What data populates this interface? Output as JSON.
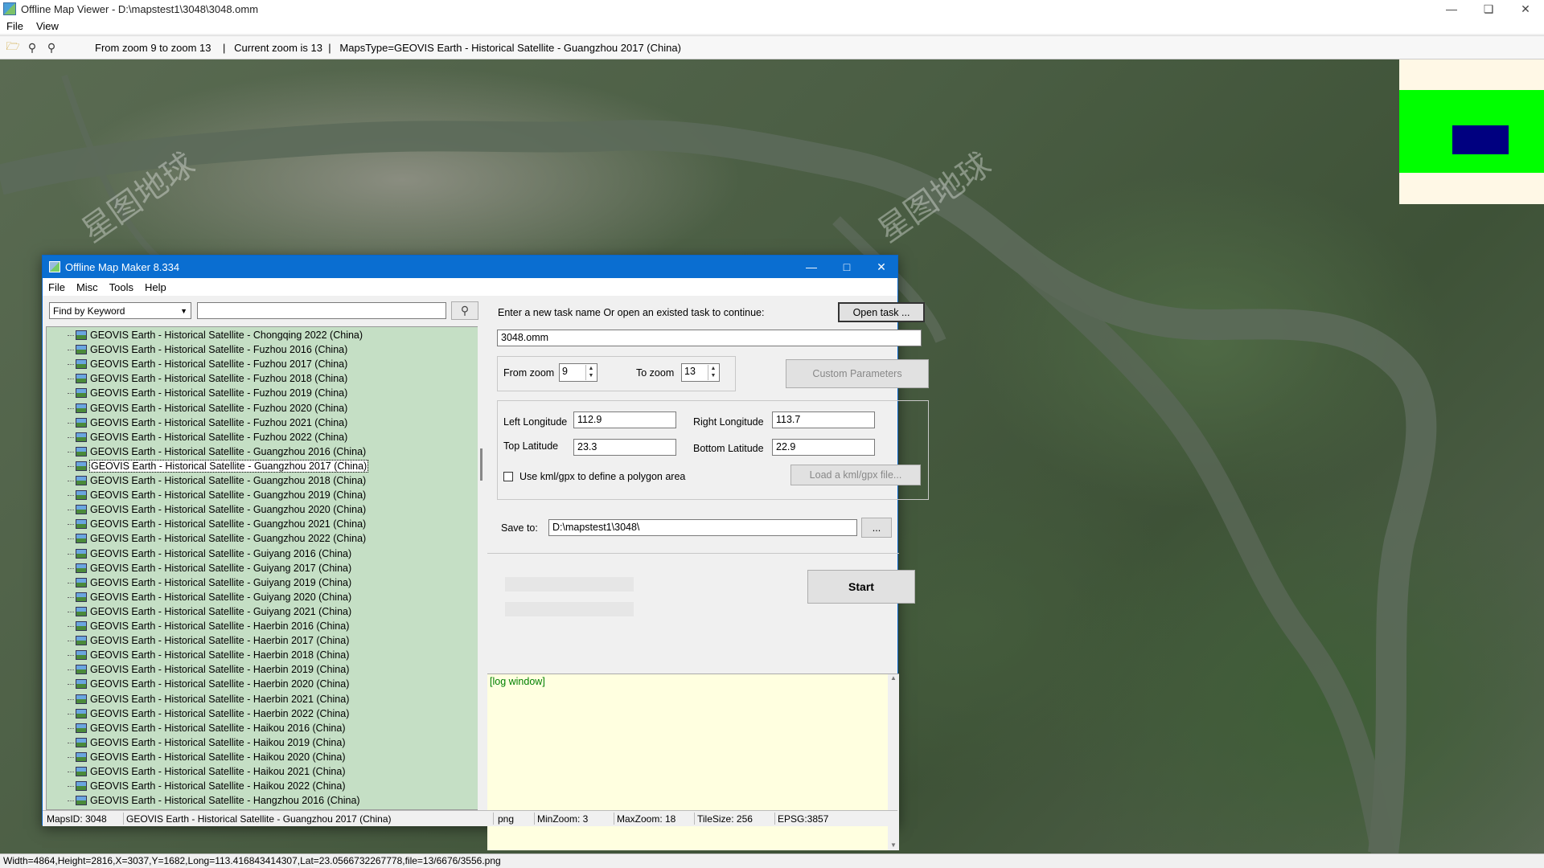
{
  "viewer": {
    "title": "Offline Map Viewer - D:\\mapstest1\\3048\\3048.omm",
    "menu": [
      "File",
      "View"
    ],
    "toolbar_info": "From zoom 9 to zoom 13    |   Current zoom is 13  |   MapsType=GEOVIS Earth - Historical Satellite - Guangzhou 2017 (China)",
    "icons": [
      "folder-open-icon",
      "zoom-out-icon",
      "zoom-in-icon"
    ],
    "status": "Width=4864,Height=2816,X=3037,Y=1682,Long=113.416843414307,Lat=23.0566732267778,file=13/6676/3556.png",
    "watermark": "星图地球"
  },
  "dialog": {
    "title": "Offline Map Maker 8.334",
    "menu": [
      "File",
      "Misc",
      "Tools",
      "Help"
    ],
    "find_by": "Find by Keyword",
    "search_value": "",
    "map_list": [
      "GEOVIS Earth - Historical Satellite - Chongqing 2022 (China)",
      "GEOVIS Earth - Historical Satellite - Fuzhou 2016 (China)",
      "GEOVIS Earth - Historical Satellite - Fuzhou 2017 (China)",
      "GEOVIS Earth - Historical Satellite - Fuzhou 2018 (China)",
      "GEOVIS Earth - Historical Satellite - Fuzhou 2019 (China)",
      "GEOVIS Earth - Historical Satellite - Fuzhou 2020 (China)",
      "GEOVIS Earth - Historical Satellite - Fuzhou 2021 (China)",
      "GEOVIS Earth - Historical Satellite - Fuzhou 2022 (China)",
      "GEOVIS Earth - Historical Satellite - Guangzhou 2016 (China)",
      "GEOVIS Earth - Historical Satellite - Guangzhou 2017 (China)",
      "GEOVIS Earth - Historical Satellite - Guangzhou 2018 (China)",
      "GEOVIS Earth - Historical Satellite - Guangzhou 2019 (China)",
      "GEOVIS Earth - Historical Satellite - Guangzhou 2020 (China)",
      "GEOVIS Earth - Historical Satellite - Guangzhou 2021 (China)",
      "GEOVIS Earth - Historical Satellite - Guangzhou 2022 (China)",
      "GEOVIS Earth - Historical Satellite - Guiyang 2016 (China)",
      "GEOVIS Earth - Historical Satellite - Guiyang 2017 (China)",
      "GEOVIS Earth - Historical Satellite - Guiyang 2019 (China)",
      "GEOVIS Earth - Historical Satellite - Guiyang 2020 (China)",
      "GEOVIS Earth - Historical Satellite - Guiyang 2021 (China)",
      "GEOVIS Earth - Historical Satellite - Haerbin 2016 (China)",
      "GEOVIS Earth - Historical Satellite - Haerbin 2017 (China)",
      "GEOVIS Earth - Historical Satellite - Haerbin 2018 (China)",
      "GEOVIS Earth - Historical Satellite - Haerbin 2019 (China)",
      "GEOVIS Earth - Historical Satellite - Haerbin 2020 (China)",
      "GEOVIS Earth - Historical Satellite - Haerbin 2021 (China)",
      "GEOVIS Earth - Historical Satellite - Haerbin 2022 (China)",
      "GEOVIS Earth - Historical Satellite - Haikou 2016 (China)",
      "GEOVIS Earth - Historical Satellite - Haikou 2019 (China)",
      "GEOVIS Earth - Historical Satellite - Haikou 2020 (China)",
      "GEOVIS Earth - Historical Satellite - Haikou 2021 (China)",
      "GEOVIS Earth - Historical Satellite - Haikou 2022 (China)",
      "GEOVIS Earth - Historical Satellite - Hangzhou 2016 (China)"
    ],
    "selected_index": 9,
    "task_prompt": "Enter a new task name Or open an existed task to continue:",
    "open_task_btn": "Open task ...",
    "task_name": "3048.omm",
    "from_zoom_label": "From zoom",
    "from_zoom": "9",
    "to_zoom_label": "To zoom",
    "to_zoom": "13",
    "custom_params_btn": "Custom Parameters",
    "left_lon_label": "Left Longitude",
    "left_lon": "112.9",
    "right_lon_label": "Right Longitude",
    "right_lon": "113.7",
    "top_lat_label": "Top Latitude",
    "top_lat": "23.3",
    "bottom_lat_label": "Bottom Latitude",
    "bottom_lat": "22.9",
    "kml_label": "Use kml/gpx to define a polygon area",
    "kml_btn": "Load a kml/gpx file...",
    "save_to_label": "Save to:",
    "save_to": "D:\\mapstest1\\3048\\",
    "browse_btn": "...",
    "start_btn": "Start",
    "log_text": "[log window]",
    "status": {
      "maps_id": "MapsID: 3048",
      "map_name": "GEOVIS Earth - Historical Satellite - Guangzhou 2017 (China)",
      "format": "png",
      "min_zoom": "MinZoom: 3",
      "max_zoom": "MaxZoom: 18",
      "tile_size": "TileSize: 256",
      "epsg": "EPSG:3857"
    }
  }
}
